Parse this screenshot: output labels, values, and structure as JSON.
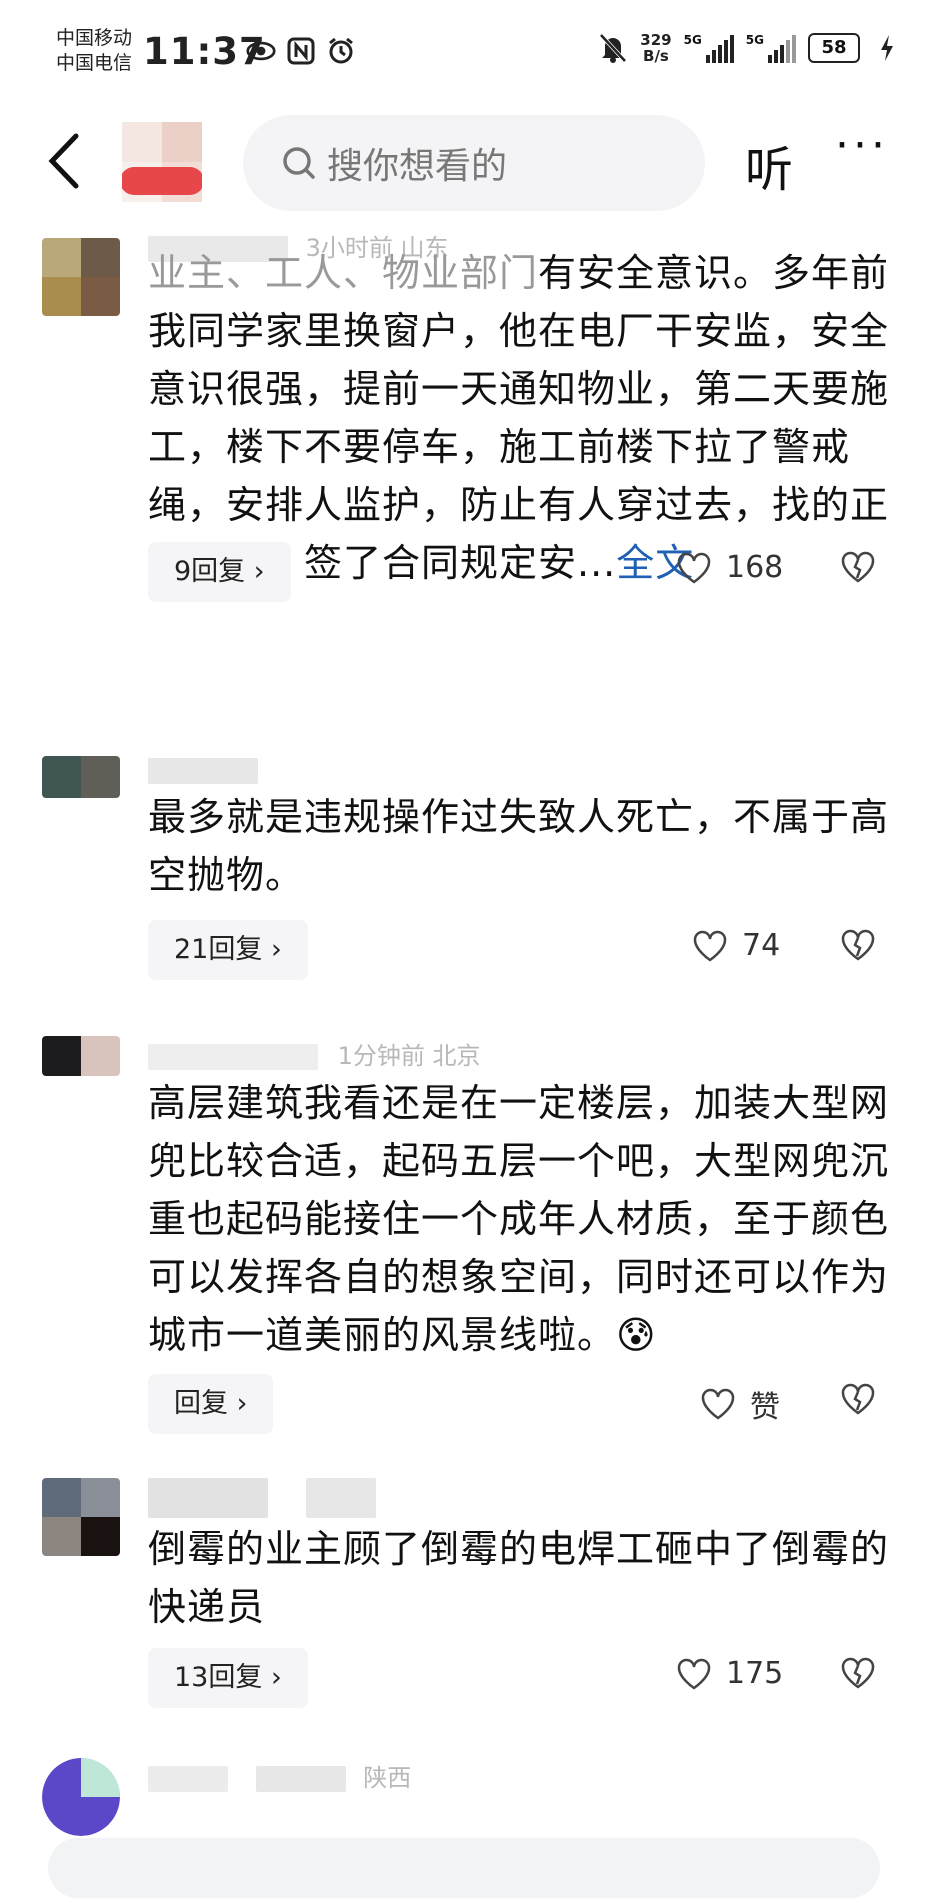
{
  "status_bar": {
    "carrier1": "中国移动",
    "carrier2": "中国电信",
    "time": "11:37",
    "net_speed_value": "329",
    "net_speed_unit": "B/s",
    "sig1_label": "5G",
    "sig2_label": "5G",
    "battery": "58"
  },
  "header": {
    "search_placeholder": "搜你想看的",
    "listen_label": "听",
    "more_label": "···"
  },
  "comments": [
    {
      "meta_visible": "3小时前 山东",
      "text": "有安全意识。多年前我同学家里换窗户，他在电厂干安监，安全意识很强，提前一天通知物业，第二天要施工，楼下不要停车，施工前楼下拉了警戒绳，安排人监护，防止有人穿过去，找的正规公司，签了合同规定安...",
      "text_prefix": "业主、工人、物业部门",
      "full_link": "全文",
      "replies": "9回复",
      "likes": "168"
    },
    {
      "meta_visible": "",
      "text": "最多就是违规操作过失致人死亡，不属于高空抛物。",
      "replies": "21回复",
      "likes": "74"
    },
    {
      "meta_visible": "1分钟前 北京",
      "text": "高层建筑我看还是在一定楼层，加装大型网兜比较合适，起码五层一个吧，大型网兜沉重也起码能接住一个成年人材质，至于颜色可以发挥各自的想象空间，同时还可以作为城市一道美丽的风景线啦。",
      "emoji": "😰",
      "replies": "回复",
      "likes": "赞"
    },
    {
      "meta_visible": "",
      "text": "倒霉的业主顾了倒霉的电焊工砸中了倒霉的快递员",
      "replies": "13回复",
      "likes": "175"
    },
    {
      "meta_visible": "陕西",
      "text": "",
      "replies": "",
      "likes": ""
    }
  ],
  "colors": {
    "link": "#1f5fb4",
    "meta": "#b8b8b8",
    "pill_bg": "#f5f5f7"
  },
  "icons": [
    "back-arrow-icon",
    "search-icon",
    "heart-icon",
    "broken-heart-icon",
    "eye-icon",
    "nfc-icon",
    "alarm-icon",
    "mute-bell-icon",
    "charging-icon"
  ]
}
